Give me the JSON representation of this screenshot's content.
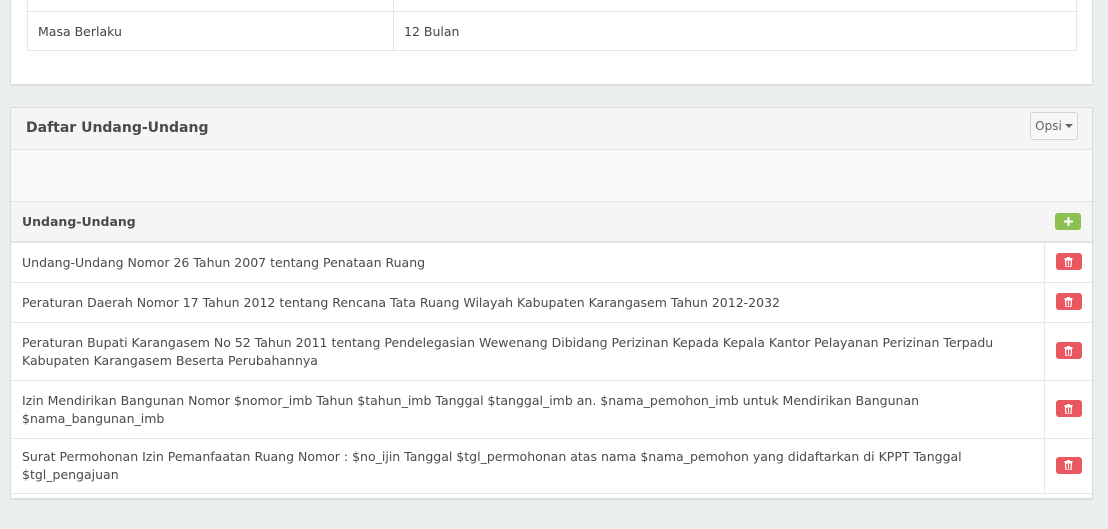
{
  "top_panel": {
    "rows": [
      {
        "label": "",
        "value": ""
      },
      {
        "label": "Masa Berlaku",
        "value": "12 Bulan"
      }
    ]
  },
  "list_panel": {
    "title": "Daftar Undang-Undang",
    "options_label": "Opsi",
    "column_header": "Undang-Undang",
    "items": [
      "Undang-Undang Nomor 26 Tahun 2007 tentang Penataan Ruang",
      "Peraturan Daerah Nomor 17 Tahun 2012 tentang Rencana Tata Ruang Wilayah Kabupaten Karangasem Tahun 2012-2032",
      "Peraturan Bupati Karangasem No 52 Tahun 2011 tentang Pendelegasian Wewenang Dibidang Perizinan Kepada Kepala Kantor Pelayanan Perizinan Terpadu Kabupaten Karangasem Beserta Perubahannya",
      "Izin Mendirikan Bangunan Nomor $nomor_imb Tahun $tahun_imb Tanggal $tanggal_imb an. $nama_pemohon_imb untuk Mendirikan Bangunan $nama_bangunan_imb",
      "Surat Permohonan Izin Pemanfaatan Ruang Nomor : $no_ijin Tanggal $tgl_permohonan atas nama $nama_pemohon yang didaftarkan di KPPT Tanggal $tgl_pengajuan"
    ]
  },
  "icons": {
    "add": "plus-icon",
    "delete": "trash-icon",
    "options": "caret-down-icon"
  },
  "colors": {
    "add_button": "#8cc152",
    "delete_button": "#e9575f",
    "background": "#ebeff0"
  }
}
